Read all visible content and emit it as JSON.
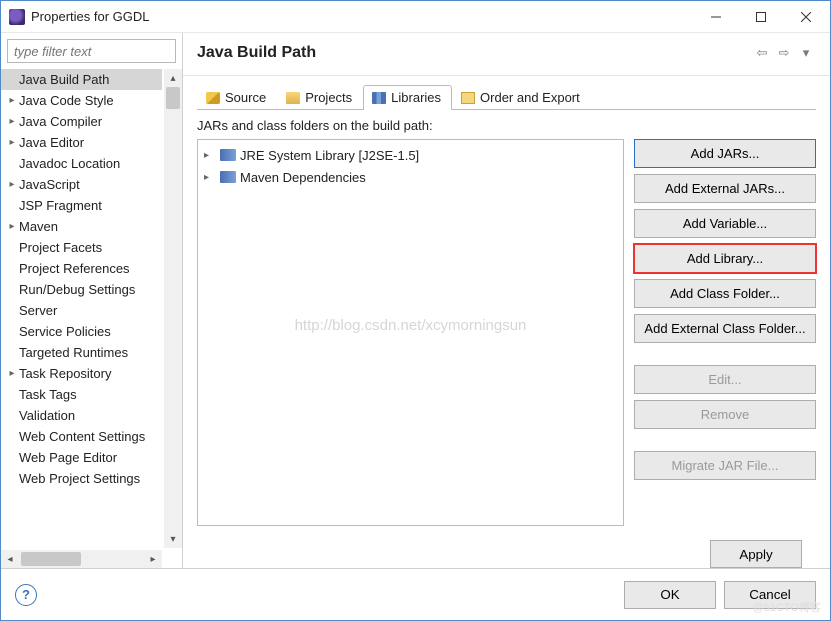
{
  "window": {
    "title": "Properties for GGDL"
  },
  "filter": {
    "placeholder": "type filter text"
  },
  "sidebar_items": [
    {
      "label": "Java Build Path",
      "expandable": false,
      "selected": true
    },
    {
      "label": "Java Code Style",
      "expandable": true
    },
    {
      "label": "Java Compiler",
      "expandable": true
    },
    {
      "label": "Java Editor",
      "expandable": true
    },
    {
      "label": "Javadoc Location",
      "expandable": false
    },
    {
      "label": "JavaScript",
      "expandable": true
    },
    {
      "label": "JSP Fragment",
      "expandable": false
    },
    {
      "label": "Maven",
      "expandable": true
    },
    {
      "label": "Project Facets",
      "expandable": false
    },
    {
      "label": "Project References",
      "expandable": false
    },
    {
      "label": "Run/Debug Settings",
      "expandable": false
    },
    {
      "label": "Server",
      "expandable": false
    },
    {
      "label": "Service Policies",
      "expandable": false
    },
    {
      "label": "Targeted Runtimes",
      "expandable": false
    },
    {
      "label": "Task Repository",
      "expandable": true
    },
    {
      "label": "Task Tags",
      "expandable": false
    },
    {
      "label": "Validation",
      "expandable": false
    },
    {
      "label": "Web Content Settings",
      "expandable": false
    },
    {
      "label": "Web Page Editor",
      "expandable": false
    },
    {
      "label": "Web Project Settings",
      "expandable": false
    }
  ],
  "page": {
    "title": "Java Build Path",
    "tabs": [
      {
        "label": "Source",
        "icon": "ic-source"
      },
      {
        "label": "Projects",
        "icon": "ic-projects"
      },
      {
        "label": "Libraries",
        "icon": "ic-libraries",
        "active": true
      },
      {
        "label": "Order and Export",
        "icon": "ic-order"
      }
    ],
    "desc": "JARs and class folders on the build path:",
    "lib_items": [
      {
        "label": "JRE System Library [J2SE-1.5]"
      },
      {
        "label": "Maven Dependencies"
      }
    ],
    "watermark": "http://blog.csdn.net/xcymorningsun",
    "buttons": {
      "add_jars": "Add JARs...",
      "add_ext_jars": "Add External JARs...",
      "add_variable": "Add Variable...",
      "add_library": "Add Library...",
      "add_class_folder": "Add Class Folder...",
      "add_ext_class_folder": "Add External Class Folder...",
      "edit": "Edit...",
      "remove": "Remove",
      "migrate": "Migrate JAR File..."
    },
    "apply": "Apply"
  },
  "footer": {
    "ok": "OK",
    "cancel": "Cancel"
  },
  "credit": "@51CTO博客"
}
